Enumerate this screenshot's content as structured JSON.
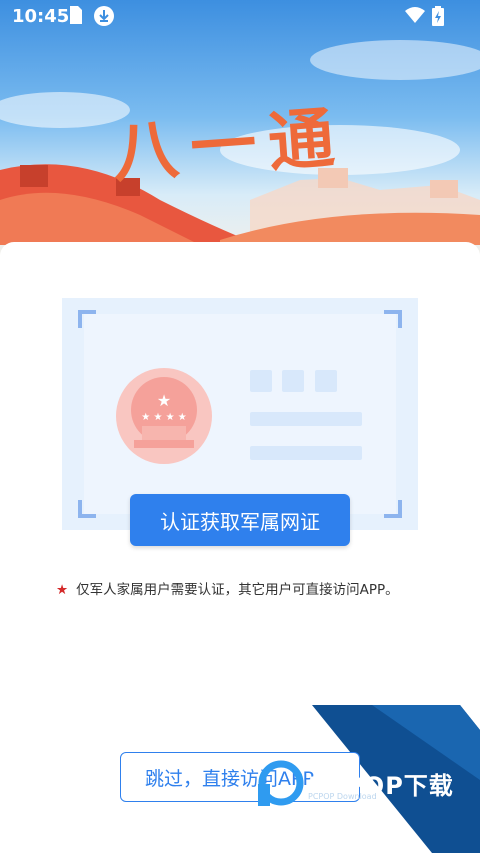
{
  "status_bar": {
    "time": "10:45",
    "icons": [
      "sim-card-icon",
      "download-icon",
      "wifi-icon",
      "battery-charging-icon"
    ]
  },
  "header": {
    "title": "八一通"
  },
  "main": {
    "certify_button_label": "认证获取军属网证",
    "notice_star": "★",
    "notice_text": "仅军人家属用户需要认证，其它用户可直接访问APP。",
    "skip_button_label": "跳过，直接访问APP"
  },
  "watermark": {
    "brand": "PCPOP下载",
    "brand_sub": "PCPOP Download"
  },
  "colors": {
    "accent": "#2f80ed",
    "star_red": "#d42a2a",
    "emblem_red": "#f6a7a2",
    "watermark_navy": "#0f4f92"
  }
}
